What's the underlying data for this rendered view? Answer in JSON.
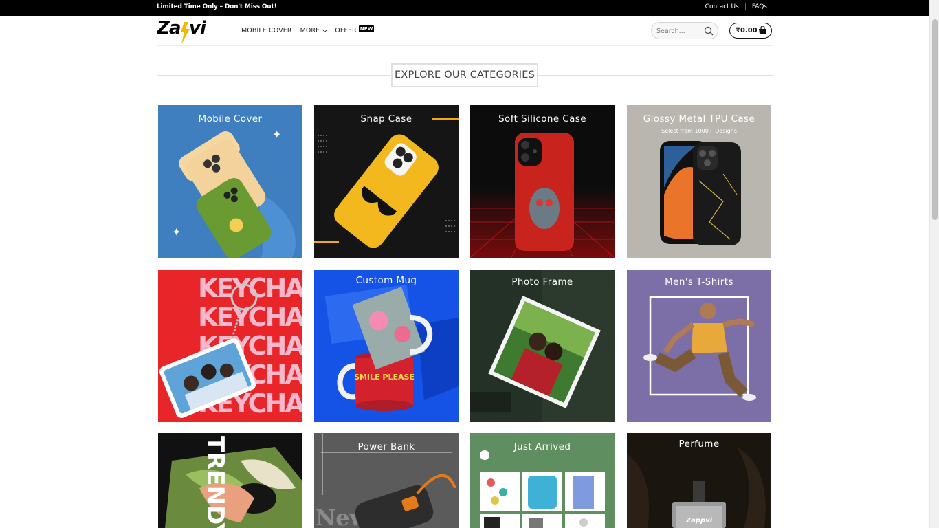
{
  "topbar": {
    "promo": "Limited Time Only – Don't Miss Out!",
    "links": [
      "Contact Us",
      "FAQs"
    ]
  },
  "header": {
    "logo_text": "Zappvi",
    "nav": [
      {
        "label": "MOBILE COVER"
      },
      {
        "label": "MORE"
      },
      {
        "label": "OFFER",
        "badge": "NEW"
      }
    ],
    "search_placeholder": "Search...",
    "cart_total": "₹0.00"
  },
  "section_title": "EXPLORE OUR CATEGORIES",
  "categories": [
    {
      "label": "Mobile Cover",
      "bg": "#3f7fc0"
    },
    {
      "label": "Snap Case",
      "bg": "#1a1a1a"
    },
    {
      "label": "Soft Silicone Case",
      "bg": "#0c0c0c"
    },
    {
      "label": "Glossy Metal TPU Case",
      "sub": "Select from 1000+ Designs",
      "bg": "#b9b6b0"
    },
    {
      "label": "KEYCHAIN",
      "bg": "#e8262a"
    },
    {
      "label": "Custom Mug",
      "bg": "#1552e6"
    },
    {
      "label": "Photo Frame",
      "bg": "#2c3a2e"
    },
    {
      "label": "Men's T-Shirts",
      "bg": "#7c6ea7"
    },
    {
      "label": "TRENDY",
      "bg": "#111111"
    },
    {
      "label": "Power Bank",
      "bg": "#5b5b5b"
    },
    {
      "label": "Just Arrived",
      "bg": "#5f8f61"
    },
    {
      "label": "Perfume",
      "bg": "#1b1510"
    }
  ],
  "tile_texts": {
    "powerbank_overlay": "New",
    "perfume_brand": "Zappvi",
    "mug_text": "SMILE PLEASE"
  }
}
